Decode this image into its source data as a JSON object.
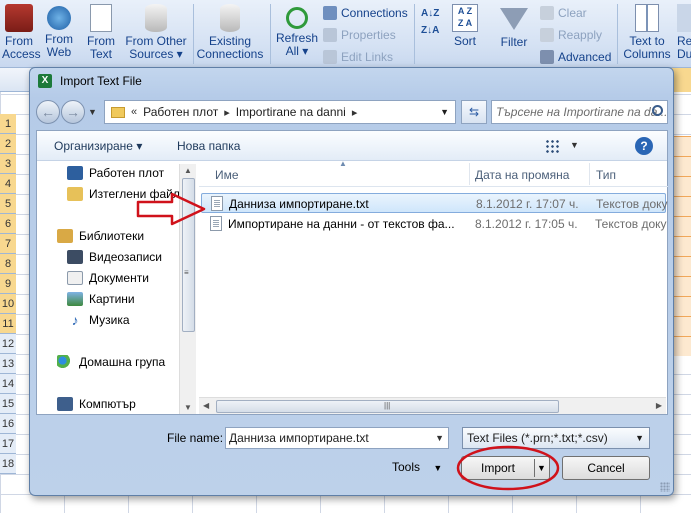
{
  "ribbon": {
    "buttons": [
      {
        "line1": "From",
        "line2": "Access"
      },
      {
        "line1": "From",
        "line2": "Web"
      },
      {
        "line1": "From",
        "line2": "Text"
      },
      {
        "line1": "From Other",
        "line2": "Sources ▾"
      },
      {
        "line1": "Existing",
        "line2": "Connections"
      },
      {
        "line1": "Refresh",
        "line2": "All ▾"
      },
      {
        "line1": "Sort",
        "line2": ""
      },
      {
        "line1": "Filter",
        "line2": ""
      },
      {
        "line1": "Text to",
        "line2": "Columns"
      },
      {
        "line1": "Re",
        "line2": "Du"
      }
    ],
    "connections": "Connections",
    "properties": "Properties",
    "edit_links": "Edit Links",
    "clear": "Clear",
    "reapply": "Reapply",
    "advanced": "Advanced"
  },
  "sheet": {
    "rows": [
      "1",
      "2",
      "3",
      "4",
      "5",
      "6",
      "7",
      "8",
      "9",
      "10",
      "11",
      "12",
      "13",
      "14",
      "15",
      "16",
      "17",
      "18"
    ]
  },
  "dialog": {
    "title": "Import Text File",
    "address": {
      "chevron": "«",
      "crumbs": [
        "Работен плот",
        "Importirane na danni"
      ]
    },
    "search_placeholder": "Търсене на Importirane na da...",
    "toolbar": {
      "organize": "Организиране ▾",
      "new_folder": "Нова папка"
    },
    "nav": {
      "items": [
        "Работен плот",
        "Изтеглени файл",
        "Библиотеки",
        "Видеозаписи",
        "Документи",
        "Картини",
        "Музика",
        "Домашна група",
        "Компютър"
      ]
    },
    "columns": {
      "name": "Име",
      "date": "Дата на промяна",
      "type": "Тип"
    },
    "files": [
      {
        "name": "Данниза импортиране.txt",
        "date": "8.1.2012 г. 17:07 ч.",
        "type": "Текстов доку"
      },
      {
        "name": "Импортиране на данни - от текстов фа...",
        "date": "8.1.2012 г. 17:05 ч.",
        "type": "Текстов доку"
      }
    ],
    "file_name_label": "File name:",
    "file_name_value": "Данниза импортиране.txt",
    "filter_value": "Text Files (*.prn;*.txt;*.csv)",
    "tools": "Tools",
    "import": "Import",
    "cancel": "Cancel"
  },
  "colors": {
    "annotation_red": "#d0121b",
    "selection_blue": "#cfe6fb",
    "ribbon_text": "#15428b"
  }
}
